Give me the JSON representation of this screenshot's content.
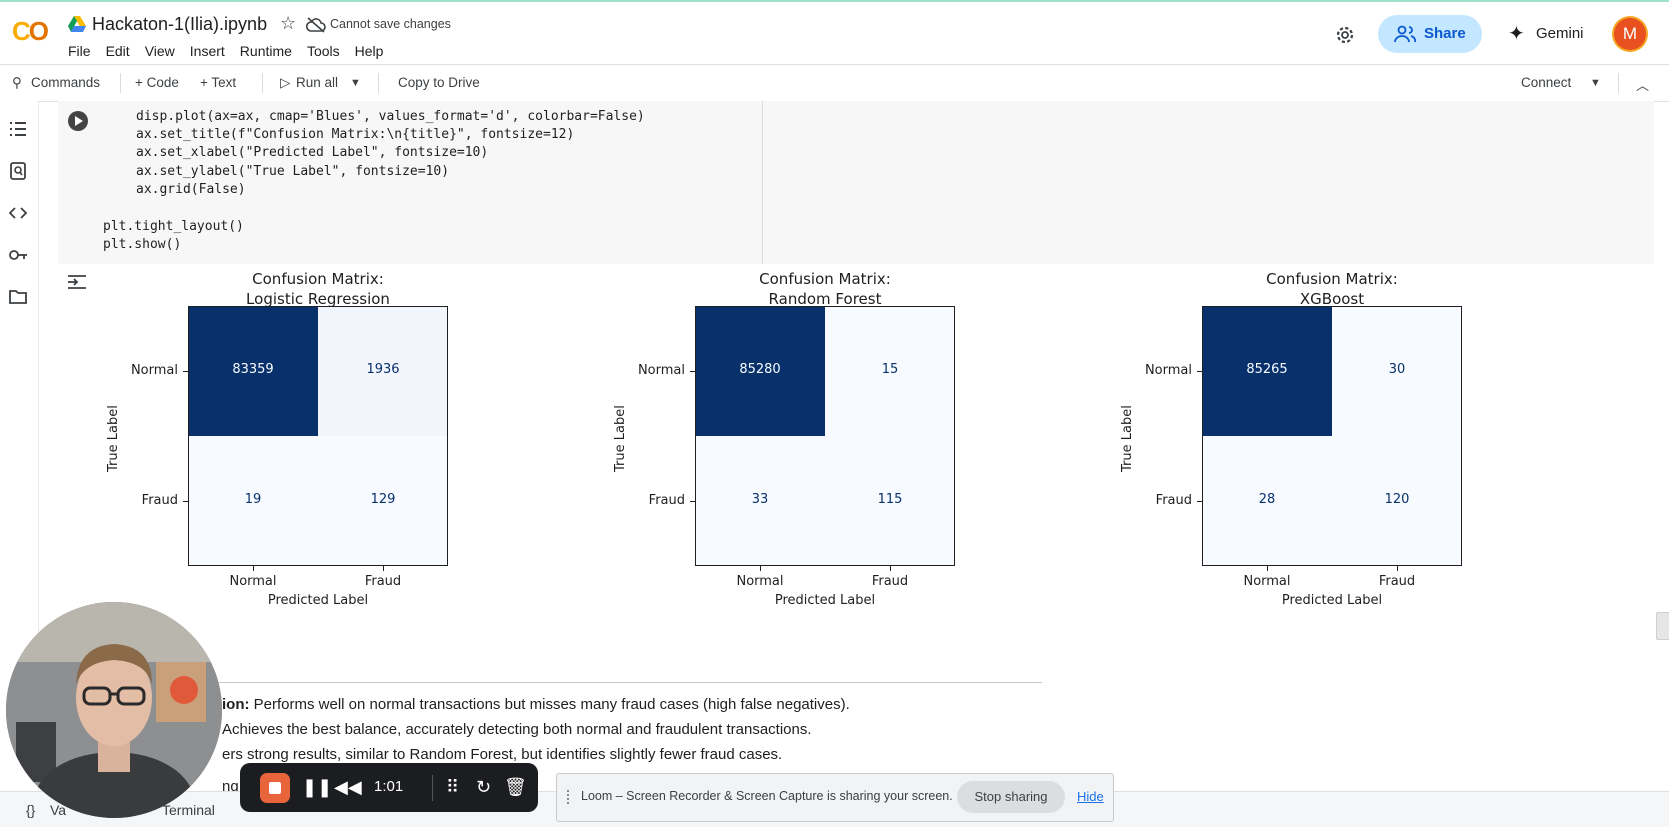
{
  "app": {
    "logo": [
      "C",
      "O"
    ],
    "title": "Hackaton-1(Ilia).ipynb",
    "save_status": "Cannot save changes",
    "menu": [
      "File",
      "Edit",
      "View",
      "Insert",
      "Runtime",
      "Tools",
      "Help"
    ],
    "share_label": "Share",
    "gemini_label": "Gemini",
    "avatar_letter": "M"
  },
  "toolbar": {
    "commands": "Commands",
    "code": "+ Code",
    "text": "+ Text",
    "run_all": "Run all",
    "copy_drive": "Copy to Drive",
    "connect": "Connect"
  },
  "code_lines": {
    "l1": "disp.plot(ax=ax, cmap='Blues', values_format='d', colorbar=False)",
    "l2": "ax.set_title(f\"Confusion Matrix:\\n{title}\", fontsize=12)",
    "l3": "ax.set_xlabel(\"Predicted Label\", fontsize=10)",
    "l4": "ax.set_ylabel(\"True Label\", fontsize=10)",
    "l5": "ax.grid(False)",
    "l6": "plt.tight_layout()",
    "l7": "plt.show()"
  },
  "chart_data": [
    {
      "type": "heatmap",
      "title": "Confusion Matrix:\nLogistic Regression",
      "title_lines": [
        "Confusion Matrix:",
        "Logistic Regression"
      ],
      "xlabel": "Predicted Label",
      "ylabel": "True Label",
      "x_categories": [
        "Normal",
        "Fraud"
      ],
      "y_categories": [
        "Normal",
        "Fraud"
      ],
      "values": [
        [
          83359,
          1936
        ],
        [
          19,
          129
        ]
      ],
      "colormap": "Blues",
      "colorbar": false
    },
    {
      "type": "heatmap",
      "title": "Confusion Matrix:\nRandom Forest",
      "title_lines": [
        "Confusion Matrix:",
        "Random Forest"
      ],
      "xlabel": "Predicted Label",
      "ylabel": "True Label",
      "x_categories": [
        "Normal",
        "Fraud"
      ],
      "y_categories": [
        "Normal",
        "Fraud"
      ],
      "values": [
        [
          85280,
          15
        ],
        [
          33,
          115
        ]
      ],
      "colormap": "Blues",
      "colorbar": false
    },
    {
      "type": "heatmap",
      "title": "Confusion Matrix:\nXGBoost",
      "title_lines": [
        "Confusion Matrix:",
        "XGBoost"
      ],
      "xlabel": "Predicted Label",
      "ylabel": "True Label",
      "x_categories": [
        "Normal",
        "Fraud"
      ],
      "y_categories": [
        "Normal",
        "Fraud"
      ],
      "values": [
        [
          85265,
          30
        ],
        [
          28,
          120
        ]
      ],
      "colormap": "Blues",
      "colorbar": false
    }
  ],
  "summary": {
    "line1_bold": "ion:",
    "line1_rest": " Performs well on normal transactions but misses many fraud cases (high false negatives).",
    "line2": "Achieves the best balance, accurately detecting both normal and fraudulent transactions.",
    "line3": "ers strong results, similar to Random Forest, but identifies slightly fewer fraud cases.",
    "line4": "ng the t"
  },
  "status_bar": {
    "variables": "Va",
    "terminal": "Terminal"
  },
  "recorder": {
    "time": "1:01"
  },
  "loom": {
    "message": "Loom – Screen Recorder & Screen Capture is sharing your screen.",
    "stop_label": "Stop sharing",
    "hide_label": "Hide"
  },
  "colors": {
    "dark_blue": "#08306b",
    "light_blue": "#f7fbff",
    "share_bg": "#c2e7ff",
    "avatar": "#e8501f"
  }
}
